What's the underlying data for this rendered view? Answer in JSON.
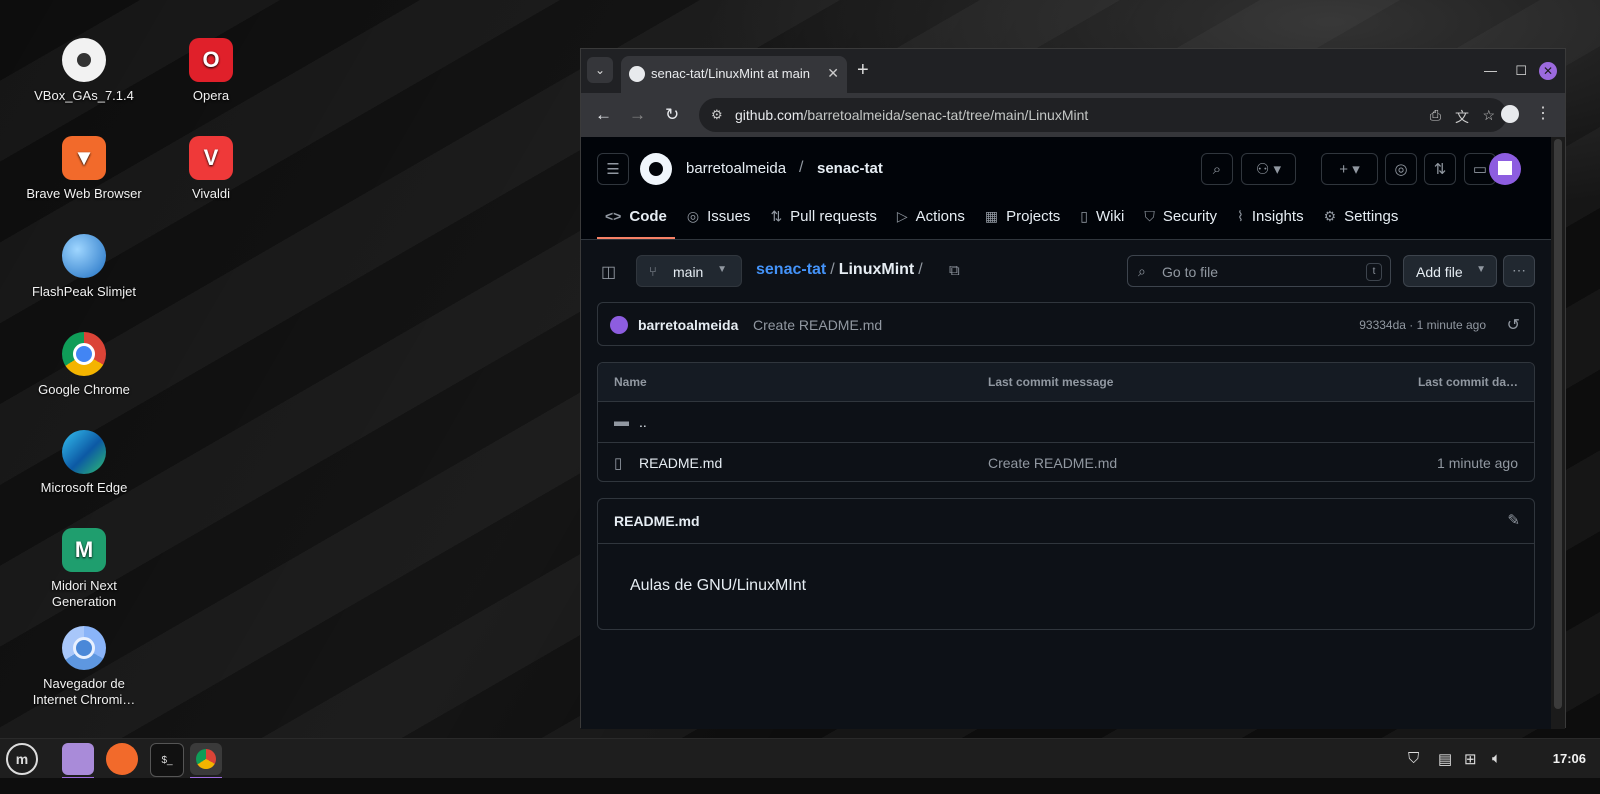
{
  "desktop": {
    "icons": [
      {
        "label": "VBox_GAs_7.1.4",
        "icon": "vbox-disc-icon"
      },
      {
        "label": "Opera",
        "icon": "opera-icon"
      },
      {
        "label": "Brave Web Browser",
        "icon": "brave-icon"
      },
      {
        "label": "Vivaldi",
        "icon": "vivaldi-icon"
      },
      {
        "label": "FlashPeak Slimjet",
        "icon": "slimjet-icon"
      },
      {
        "label": "Google Chrome",
        "icon": "chrome-icon"
      },
      {
        "label": "Microsoft Edge",
        "icon": "edge-icon"
      },
      {
        "label": "Midori Next Generation",
        "icon": "midori-icon"
      },
      {
        "label": "Navegador de Internet Chromi…",
        "icon": "chromium-icon"
      }
    ]
  },
  "browser": {
    "tab_title": "senac-tat/LinuxMint at main",
    "url_domain": "github.com",
    "url_path": "/barretoalmeida/senac-tat/tree/main/LinuxMint"
  },
  "github": {
    "owner": "barretoalmeida",
    "repo": "senac-tat",
    "nav": [
      "Code",
      "Issues",
      "Pull requests",
      "Actions",
      "Projects",
      "Wiki",
      "Security",
      "Insights",
      "Settings"
    ],
    "branch": "main",
    "breadcrumb": {
      "repo": "senac-tat",
      "folder": "LinuxMint",
      "trail": "/"
    },
    "go_to_file_placeholder": "Go to file",
    "go_to_file_key": "t",
    "add_file": "Add file",
    "latest_commit": {
      "author": "barretoalmeida",
      "message": "Create README.md",
      "meta": "93334da · 1 minute ago"
    },
    "table": {
      "headers": [
        "Name",
        "Last commit message",
        "Last commit da…"
      ],
      "rows": [
        {
          "name": "..",
          "message": "",
          "date": ""
        },
        {
          "name": "README.md",
          "message": "Create README.md",
          "date": "1 minute ago"
        }
      ]
    },
    "readme": {
      "title": "README.md",
      "content": "Aulas de GNU/LinuxMInt"
    }
  },
  "taskbar": {
    "clock": "17:06"
  }
}
